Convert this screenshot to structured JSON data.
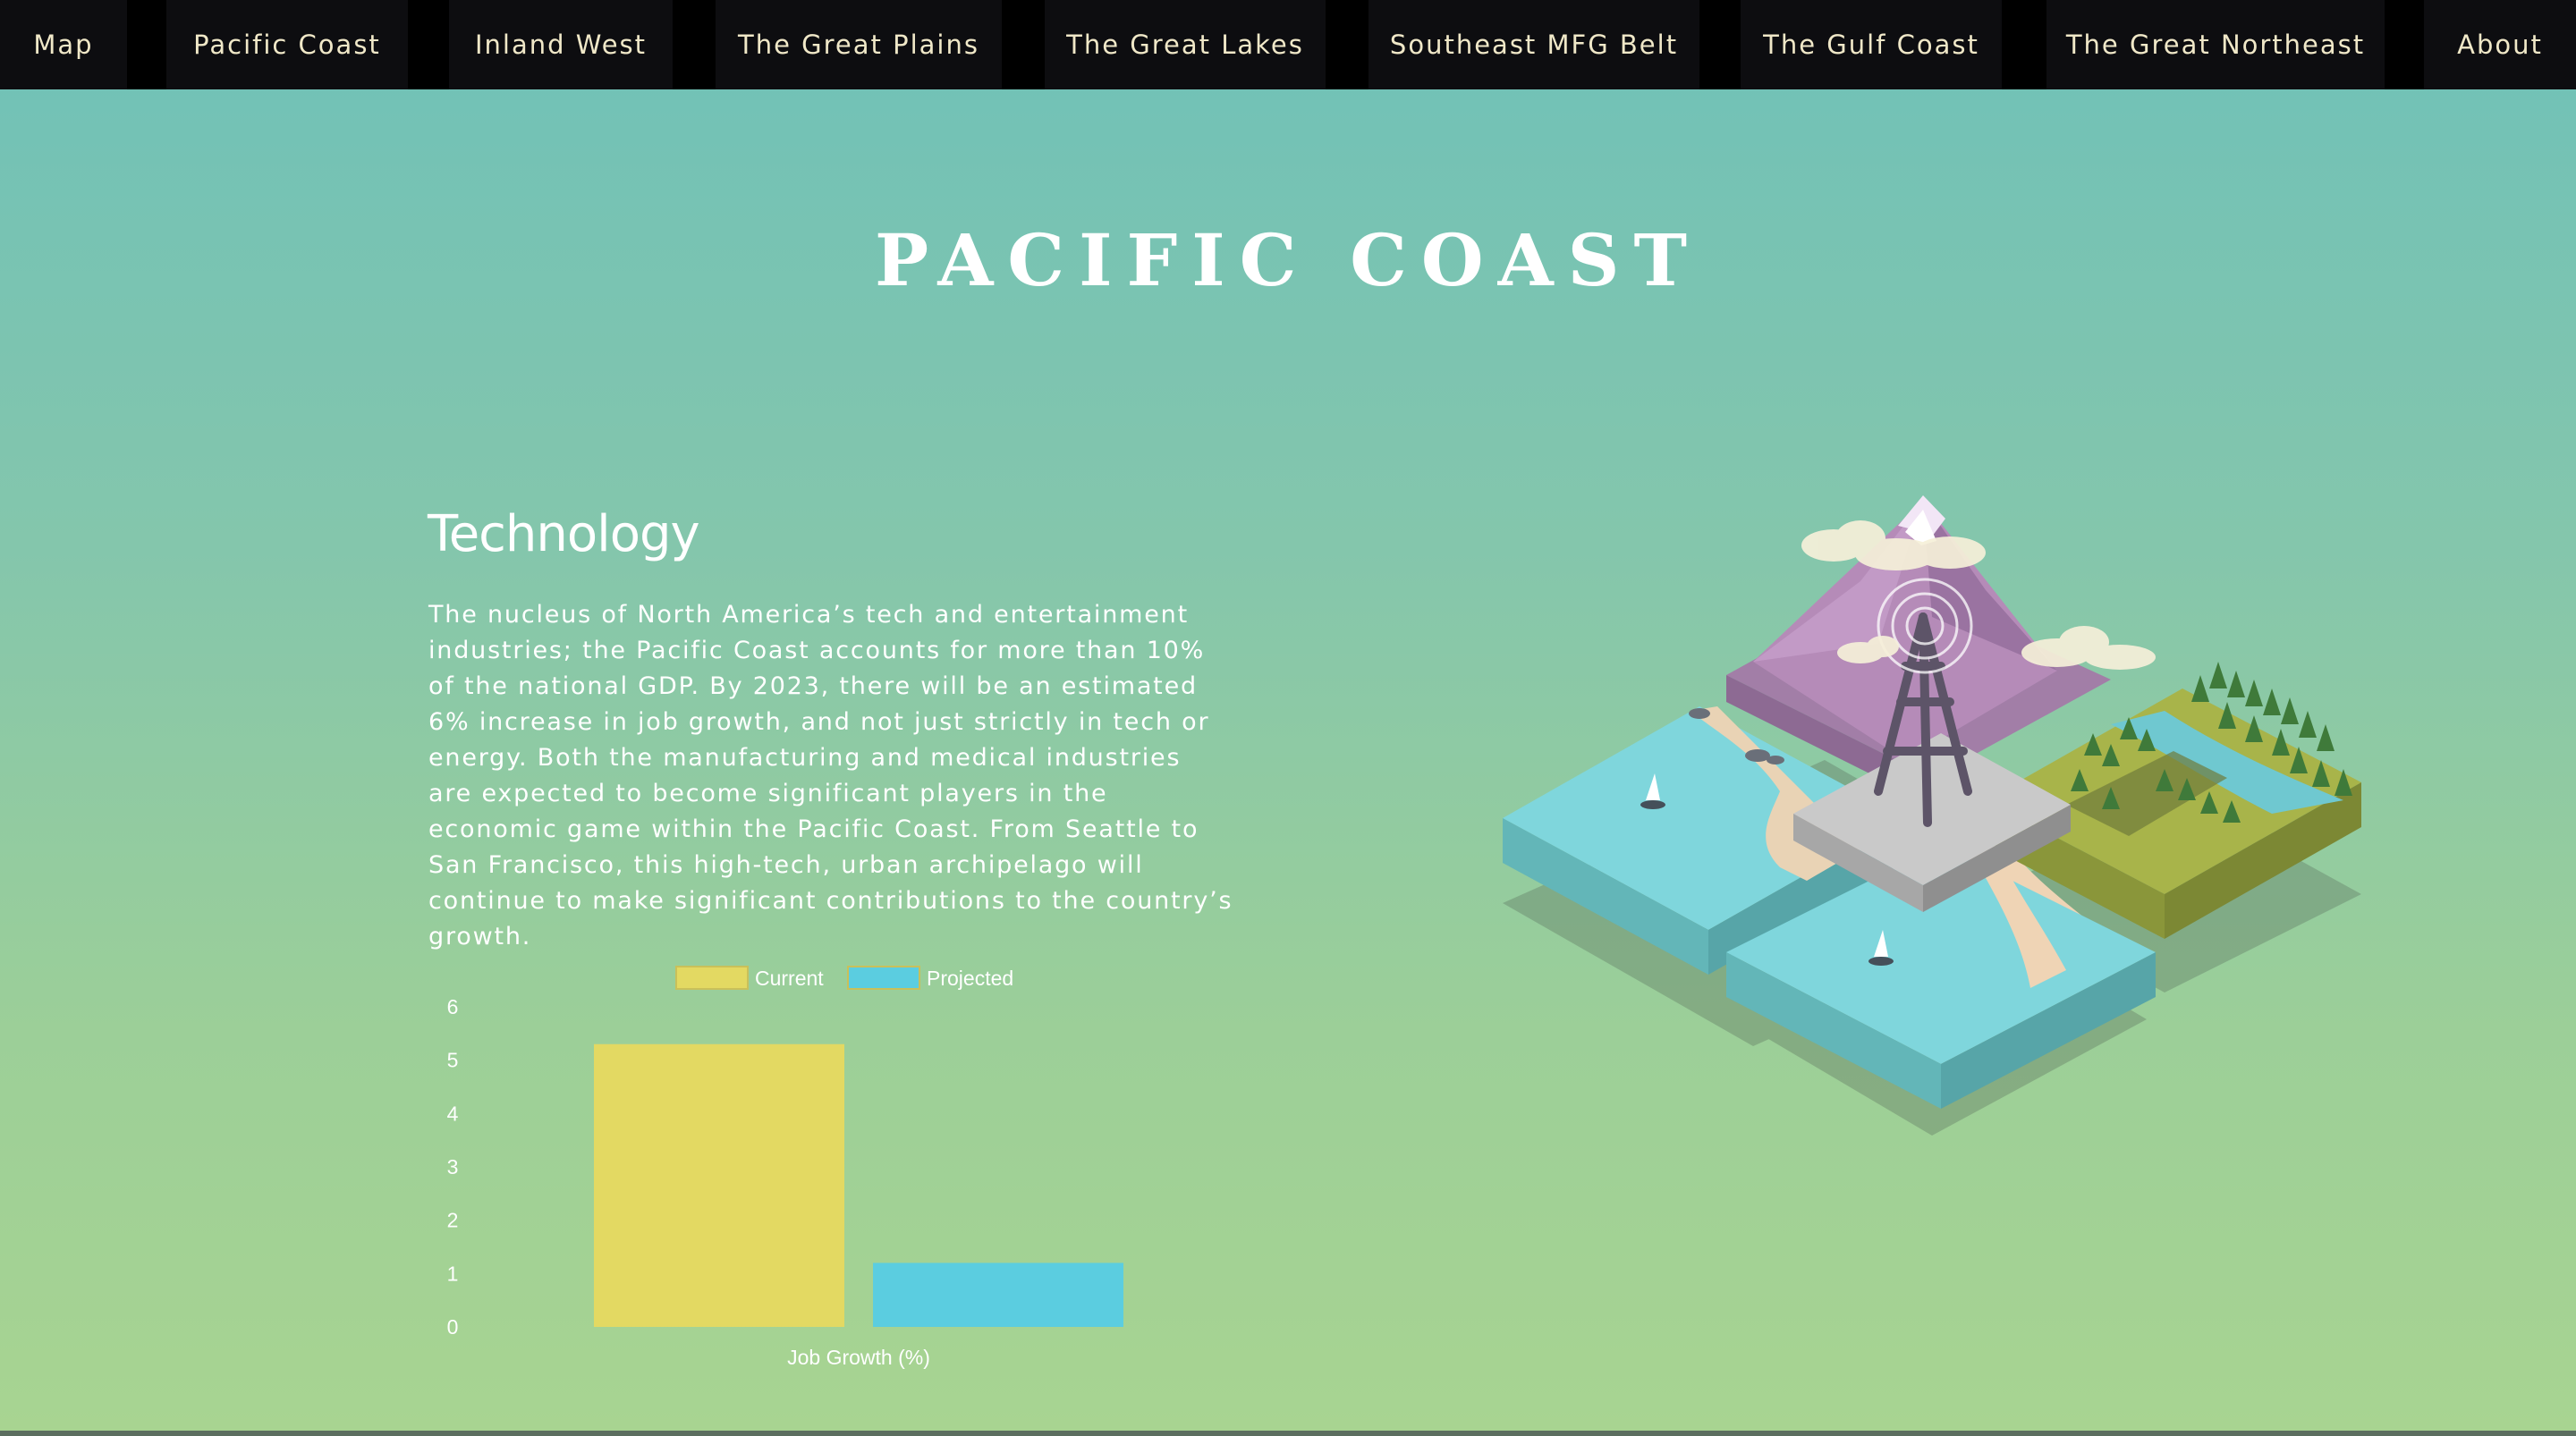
{
  "nav": {
    "items": [
      {
        "label": "Map"
      },
      {
        "label": "Pacific Coast"
      },
      {
        "label": "Inland West"
      },
      {
        "label": "The Great Plains"
      },
      {
        "label": "The Great Lakes"
      },
      {
        "label": "Southeast MFG Belt"
      },
      {
        "label": "The Gulf Coast"
      },
      {
        "label": "The Great Northeast"
      },
      {
        "label": "About"
      }
    ]
  },
  "page": {
    "title": "PACIFIC COAST"
  },
  "section": {
    "heading": "Technology",
    "body": "The nucleus of North America’s tech and entertainment industries; the Pacific Coast accounts for more than 10% of the national GDP. By 2023, there will be an estimated 6% increase in job growth, and not just strictly in tech or energy. Both the manufacturing and medical industries are expected to become significant players in the economic game within the Pacific Coast. From Seattle to San Francisco, this high-tech, urban archipelago will continue to make significant contributions to the country’s growth."
  },
  "chart_data": {
    "type": "bar",
    "categories": [
      "Job Growth (%)"
    ],
    "series": [
      {
        "name": "Current",
        "values": [
          5.3
        ],
        "color": "#e3d962"
      },
      {
        "name": "Projected",
        "values": [
          1.2
        ],
        "color": "#5bcde0"
      }
    ],
    "xlabel": "Job Growth (%)",
    "ylabel": "",
    "ylim": [
      0,
      6
    ],
    "yticks": [
      "0",
      "1",
      "2",
      "3",
      "4",
      "5",
      "6"
    ],
    "legend": "top-center",
    "grid": false
  },
  "illustration": {
    "icon": "isometric-pacific-coast-landscape-icon"
  }
}
